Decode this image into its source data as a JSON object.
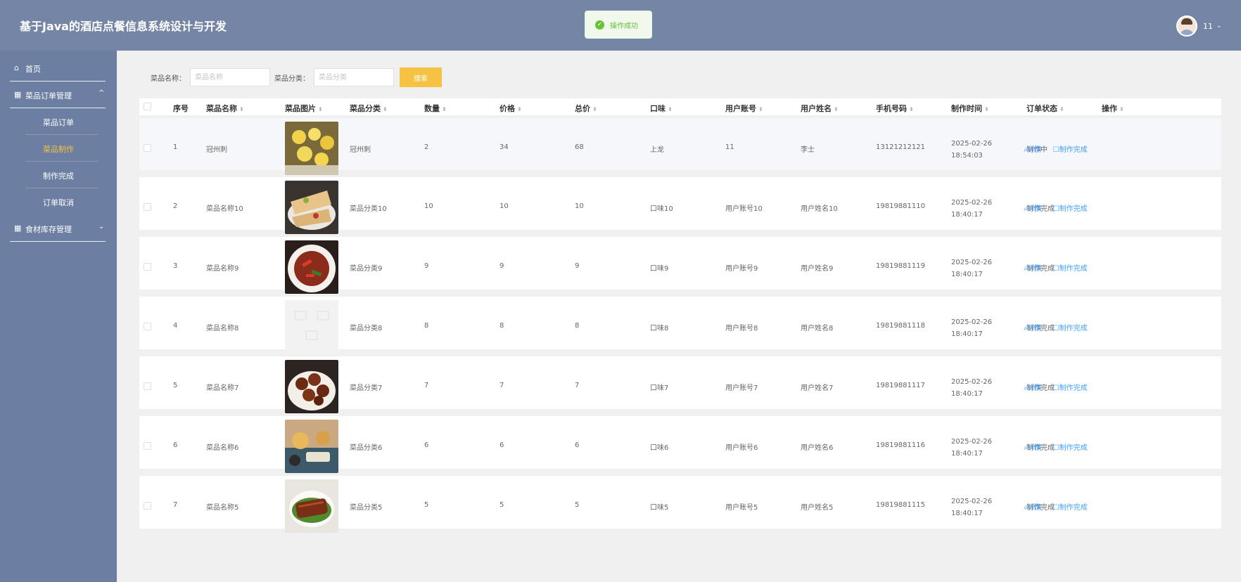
{
  "header": {
    "title": "基于Java的酒店点餐信息系统设计与开发",
    "toast": "操作成功",
    "username": "11"
  },
  "sidebar": {
    "items": [
      {
        "label": "首页"
      },
      {
        "label": "菜品订单管理",
        "children": [
          "菜品订单",
          "菜品制作",
          "制作完成",
          "订单取消"
        ],
        "active": "菜品制作"
      },
      {
        "label": "食材库存管理"
      }
    ]
  },
  "search": {
    "name_label": "菜品名称：",
    "name_placeholder": "菜品名称",
    "category_label": "菜品分类：",
    "category_placeholder": "菜品分类",
    "button": "搜索"
  },
  "table": {
    "columns": [
      "序号",
      "菜品名称",
      "菜品图片",
      "菜品分类",
      "数量",
      "价格",
      "总价",
      "口味",
      "用户账号",
      "用户姓名",
      "手机号码",
      "制作时间",
      "订单状态",
      "操作"
    ],
    "actions": {
      "detail": "详情",
      "complete": "制作完成"
    },
    "rows": [
      {
        "no": "1",
        "name": "冠州刺",
        "image": "yellow-dumplings",
        "category": "冠州刺",
        "qty": "2",
        "price": "34",
        "total": "68",
        "taste": "上龙",
        "account": "11",
        "user": "李士",
        "phone": "13121212121",
        "time": "2025-02-26 18:54:03",
        "status": "制作中"
      },
      {
        "no": "2",
        "name": "菜品名称10",
        "image": "wraps",
        "category": "菜品分类10",
        "qty": "10",
        "price": "10",
        "total": "10",
        "taste": "口味10",
        "account": "用户账号10",
        "user": "用户姓名10",
        "phone": "19819881110",
        "time": "2025-02-26 18:40:17",
        "status": "制作完成"
      },
      {
        "no": "3",
        "name": "菜品名称9",
        "image": "stir-fry",
        "category": "菜品分类9",
        "qty": "9",
        "price": "9",
        "total": "9",
        "taste": "口味9",
        "account": "用户账号9",
        "user": "用户姓名9",
        "phone": "19819881119",
        "time": "2025-02-26 18:40:17",
        "status": "制作完成"
      },
      {
        "no": "4",
        "name": "菜品名称8",
        "image": "placeholder",
        "category": "菜品分类8",
        "qty": "8",
        "price": "8",
        "total": "8",
        "taste": "口味8",
        "account": "用户账号8",
        "user": "用户姓名8",
        "phone": "19819881118",
        "time": "2025-02-26 18:40:17",
        "status": "制作完成"
      },
      {
        "no": "5",
        "name": "菜品名称7",
        "image": "braised",
        "category": "菜品分类7",
        "qty": "7",
        "price": "7",
        "total": "7",
        "taste": "口味7",
        "account": "用户账号7",
        "user": "用户姓名7",
        "phone": "19819881117",
        "time": "2025-02-26 18:40:17",
        "status": "制作完成"
      },
      {
        "no": "6",
        "name": "菜品名称6",
        "image": "plates",
        "category": "菜品分类6",
        "qty": "6",
        "price": "6",
        "total": "6",
        "taste": "口味6",
        "account": "用户账号6",
        "user": "用户姓名6",
        "phone": "19819881116",
        "time": "2025-02-26 18:40:17",
        "status": "制作完成"
      },
      {
        "no": "7",
        "name": "菜品名称5",
        "image": "pork-slices",
        "category": "菜品分类5",
        "qty": "5",
        "price": "5",
        "total": "5",
        "taste": "口味5",
        "account": "用户账号5",
        "user": "用户姓名5",
        "phone": "19819881115",
        "time": "2025-02-26 18:40:17",
        "status": "制作完成"
      }
    ]
  },
  "colors": {
    "header": "#7585a5",
    "sidebar": "#6c7ea1",
    "accent": "#f5c242",
    "link": "#409eff",
    "success": "#67c23a"
  }
}
